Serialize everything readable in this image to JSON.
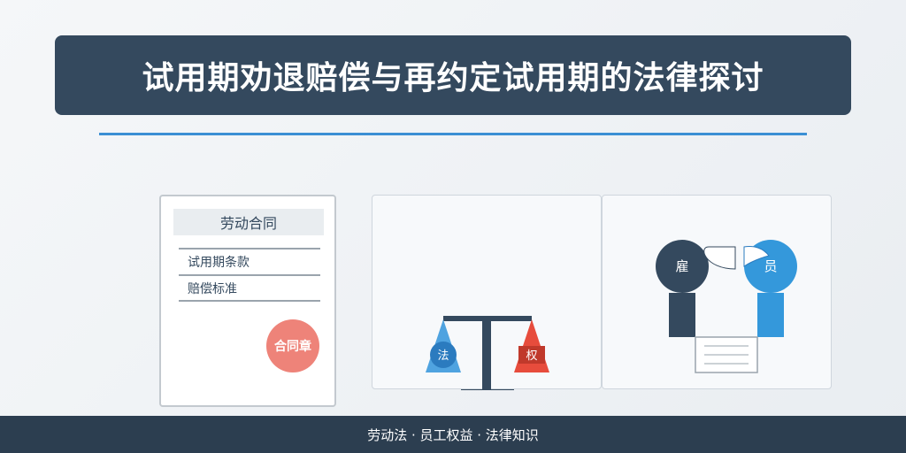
{
  "header": {
    "title": "试用期劝退赔偿与再约定试用期的法律探讨"
  },
  "contract": {
    "heading": "劳动合同",
    "clauses": [
      "试用期条款",
      "赔偿标准"
    ],
    "seal": "合同章"
  },
  "scale": {
    "left_label": "法",
    "right_label": "权"
  },
  "parties": {
    "employer": "雇",
    "employee": "员"
  },
  "footer": {
    "text": "劳动法 · 员工权益 · 法律知识"
  },
  "colors": {
    "banner": "#34495e",
    "accent_blue": "#3b8fd4",
    "accent_red": "#e74c3c",
    "seal_red": "#ee8379",
    "footer": "#2c3e50"
  }
}
